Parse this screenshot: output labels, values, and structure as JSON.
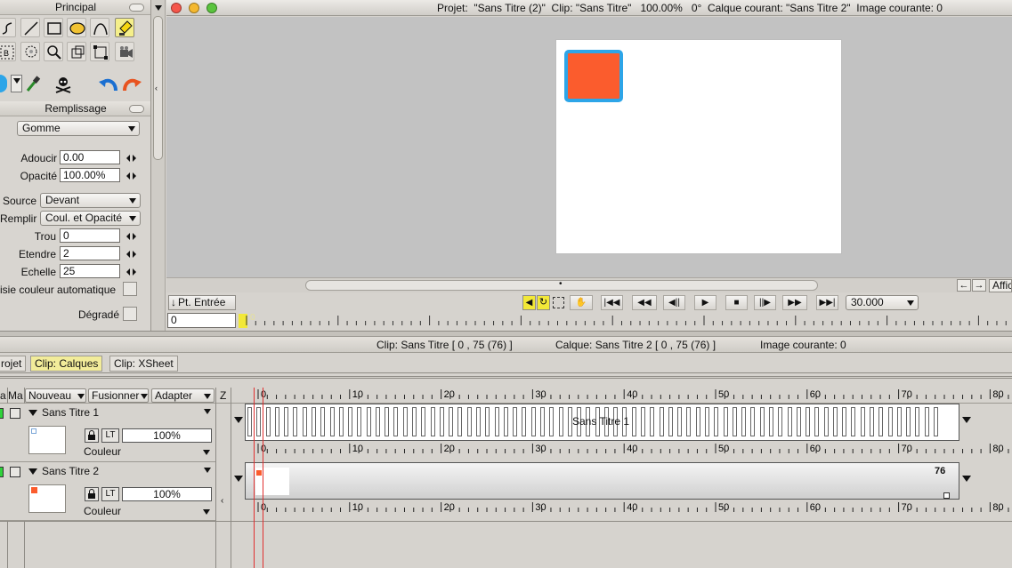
{
  "toolbox": {
    "title": "Principal",
    "fill_title": "Remplissage",
    "fill_mode": "Gomme",
    "fields": [
      {
        "label": "Adoucir",
        "value": "0.00"
      },
      {
        "label": "Opacité",
        "value": "100.00%"
      }
    ],
    "source_label": "Source",
    "source_value": "Devant",
    "remplir_label": "Remplir",
    "remplir_value": "Coul. et Opacité",
    "trou_label": "Trou",
    "trou_value": "0",
    "etendre_label": "Etendre",
    "etendre_value": "2",
    "echelle_label": "Echelle",
    "echelle_value": "25",
    "auto_color_label": "isie couleur automatique",
    "gradient_label": "Dégradé"
  },
  "window": {
    "title": "Projet:  \"Sans Titre (2)\"  Clip: \"Sans Titre\"   100.00%   0°  Calque courant: \"Sans Titre 2\"  Image courante: 0",
    "afficher_label": "Affic",
    "entry_point_label": "Pt. Entrée",
    "frame_input": "0",
    "ruler_marker": "0",
    "fps": "30.000"
  },
  "status": {
    "clip": "Clip: Sans Titre [ 0 , 75  (76) ]",
    "calque": "Calque: Sans Titre 2 [ 0 , 75  (76) ]",
    "image": "Image courante: 0"
  },
  "tabs": [
    {
      "label": "rojet"
    },
    {
      "label": "Clip: Calques"
    },
    {
      "label": "Clip: XSheet"
    }
  ],
  "header": {
    "col_a": "a",
    "col_ma": "Ma",
    "nouveau": "Nouveau",
    "fusionner": "Fusionner",
    "adapter": "Adapter",
    "z": "Z"
  },
  "ruler": {
    "labels": [
      "0",
      "10",
      "20",
      "30",
      "40",
      "50",
      "60",
      "70",
      "80"
    ]
  },
  "layers": [
    {
      "name": "Sans Titre 1",
      "opacity": "100%",
      "mode": "Couleur",
      "bar_label": "Sans Titre 1",
      "end_label": ""
    },
    {
      "name": "Sans Titre 2",
      "opacity": "100%",
      "mode": "Couleur",
      "bar_label": "",
      "end_label": "76"
    }
  ],
  "colors": {
    "shape_fill": "#fb5c2d",
    "shape_border": "#2da5e8",
    "active_tab": "#f2ec9a",
    "green_indicator": "#2fd23a",
    "playhead": "#e03030"
  }
}
